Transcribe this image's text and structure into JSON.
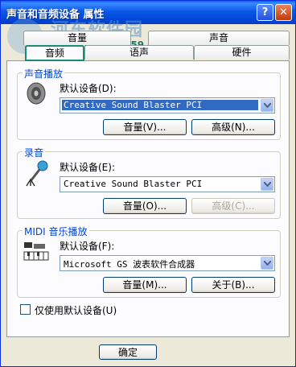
{
  "window": {
    "title": "声音和音频设备 属性",
    "help_glyph": "?",
    "close_glyph": "✕"
  },
  "watermark": {
    "title": "河东软件园",
    "url": "www.pc0359.cn"
  },
  "tabs": {
    "row1": [
      "音量",
      "声音"
    ],
    "row2": [
      "音频",
      "语声",
      "硬件"
    ],
    "active": "音频"
  },
  "playback": {
    "title": "声音播放",
    "default_label": "默认设备(D):",
    "device": "Creative Sound Blaster PCI",
    "volume_button": "音量(V)...",
    "advanced_button": "高级(N)..."
  },
  "recording": {
    "title": "录音",
    "default_label": "默认设备(E):",
    "device": "Creative Sound Blaster PCI",
    "volume_button": "音量(O)...",
    "advanced_button": "高级(C)..."
  },
  "midi": {
    "title": "MIDI 音乐播放",
    "default_label": "默认设备(F):",
    "device": "Microsoft GS 波表软件合成器",
    "volume_button": "音量(M)...",
    "about_button": "关于(B)..."
  },
  "options": {
    "use_default_only": "仅使用默认设备(U)",
    "use_default_only_checked": false
  },
  "footer": {
    "ok_button": "确定"
  },
  "colors": {
    "title_bar": "#0a58e7",
    "group_title": "#0046d5",
    "selection": "#316ac5",
    "active_tab_accent": "#e68b2c"
  }
}
